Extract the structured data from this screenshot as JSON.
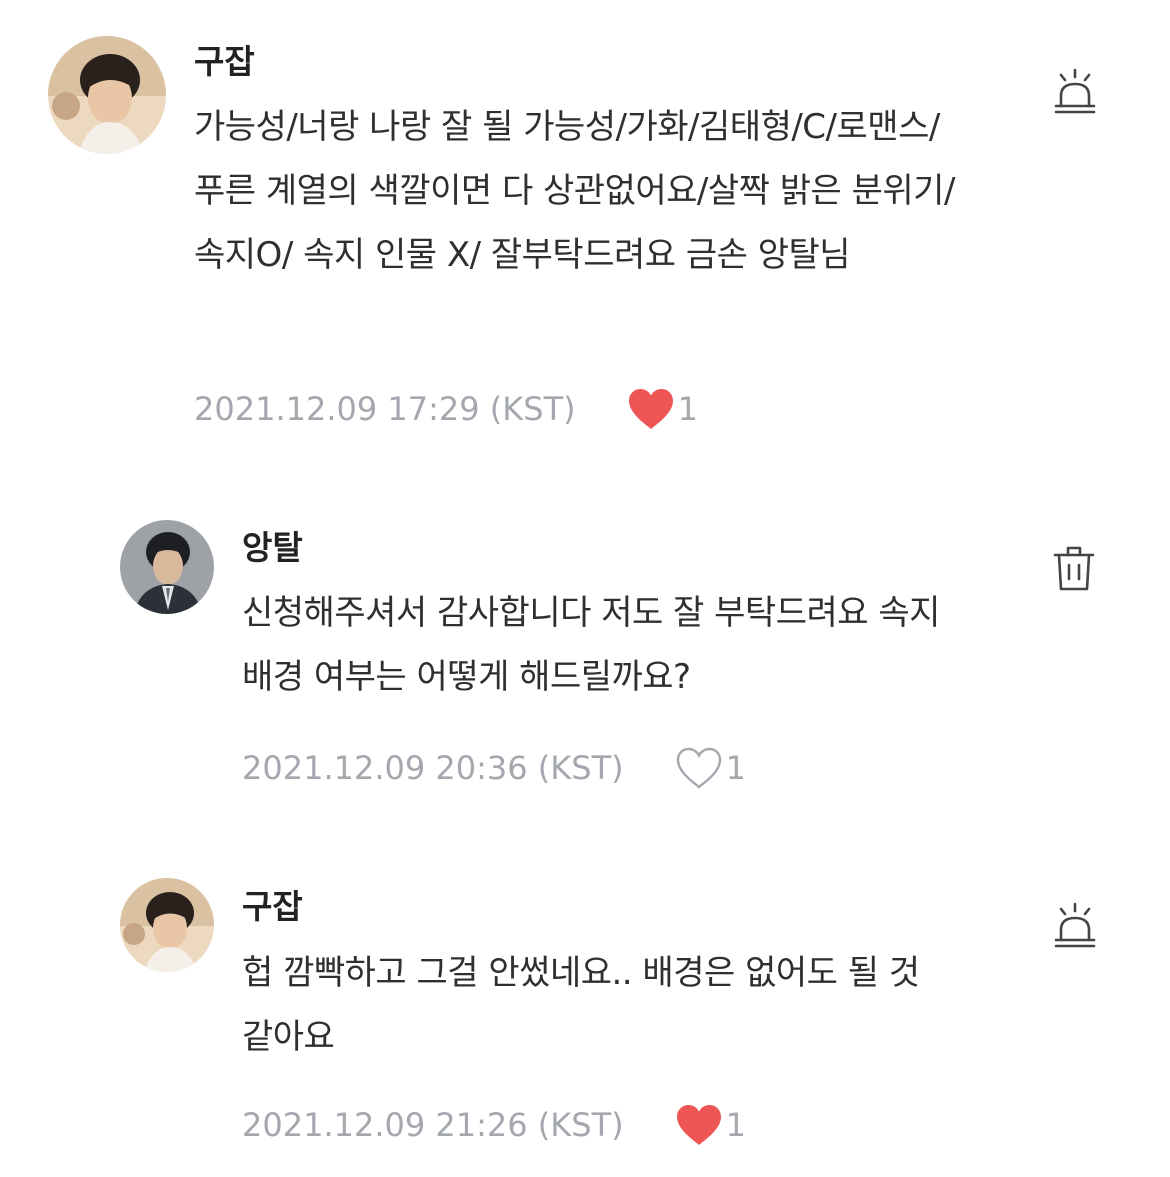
{
  "comments": [
    {
      "author": "구잡",
      "text": "가능성/너랑 나랑 잘 될 가능성/가화/김태형/C/로맨스/푸른 계열의 색깔이면 다 상관없어요/살짝 밝은 분위기/ 속지O/ 속지 인물 X/ 잘부탁드려요 금손 앙탈님",
      "timestamp": "2021.12.09 17:29 (KST)",
      "likes": "1",
      "liked": true,
      "action_icon": "siren-report-icon"
    },
    {
      "author": "앙탈",
      "text": "신청해주셔서 감사합니다 저도 잘 부탁드려요 속지 배경 여부는 어떻게 해드릴까요?",
      "timestamp": "2021.12.09 20:36 (KST)",
      "likes": "1",
      "liked": false,
      "action_icon": "trash-icon"
    },
    {
      "author": "구잡",
      "text": "헙 깜빡하고 그걸 안썼네요.. 배경은 없어도 될 것 같아요",
      "timestamp": "2021.12.09 21:26 (KST)",
      "likes": "1",
      "liked": true,
      "action_icon": "siren-report-icon"
    }
  ],
  "colors": {
    "heart_filled": "#ee5555",
    "meta_text": "#a4a8ae",
    "icon_stroke": "#444444"
  }
}
